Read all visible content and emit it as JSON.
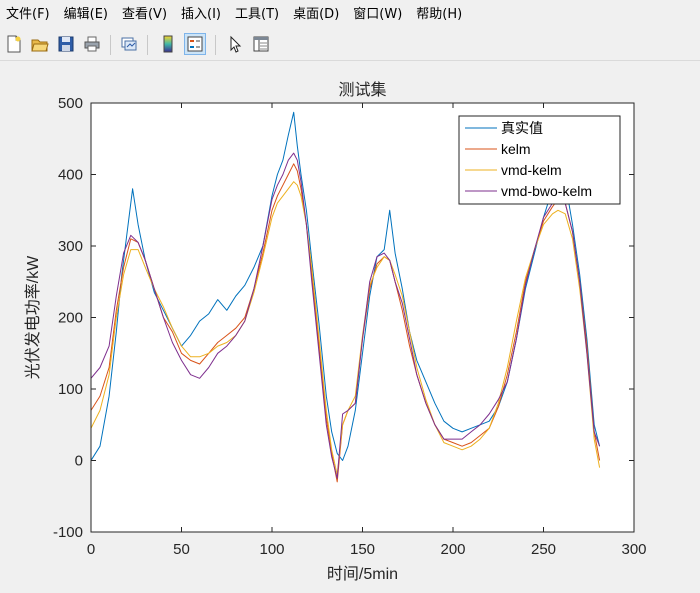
{
  "menu": [
    "文件(F)",
    "编辑(E)",
    "查看(V)",
    "插入(I)",
    "工具(T)",
    "桌面(D)",
    "窗口(W)",
    "帮助(H)"
  ],
  "toolbar": {
    "buttons": [
      "new-figure-icon",
      "open-file-icon",
      "save-icon",
      "print-icon",
      "link-plot-icon",
      "colorbar-icon",
      "legend-icon",
      "pointer-icon",
      "property-editor-icon"
    ],
    "active": "legend-icon"
  },
  "chart_data": {
    "type": "line",
    "title": "测试集",
    "xlabel": "时间/5min",
    "ylabel": "光伏发电功率/kW",
    "xlim": [
      0,
      300
    ],
    "ylim": [
      -100,
      500
    ],
    "xticks": [
      0,
      50,
      100,
      150,
      200,
      250,
      300
    ],
    "yticks": [
      -100,
      0,
      100,
      200,
      300,
      400,
      500
    ],
    "legend_position": "top-right",
    "grid": false,
    "series": [
      {
        "name": "真实值",
        "color": "#0072bd",
        "points": [
          [
            0,
            0
          ],
          [
            5,
            20
          ],
          [
            10,
            90
          ],
          [
            14,
            180
          ],
          [
            17,
            260
          ],
          [
            20,
            320
          ],
          [
            23,
            380
          ],
          [
            26,
            330
          ],
          [
            30,
            280
          ],
          [
            35,
            235
          ],
          [
            40,
            210
          ],
          [
            45,
            185
          ],
          [
            50,
            160
          ],
          [
            55,
            175
          ],
          [
            60,
            195
          ],
          [
            65,
            205
          ],
          [
            70,
            225
          ],
          [
            75,
            210
          ],
          [
            80,
            230
          ],
          [
            85,
            245
          ],
          [
            90,
            270
          ],
          [
            95,
            300
          ],
          [
            100,
            370
          ],
          [
            103,
            400
          ],
          [
            106,
            420
          ],
          [
            109,
            455
          ],
          [
            112,
            487
          ],
          [
            114,
            440
          ],
          [
            116,
            400
          ],
          [
            119,
            350
          ],
          [
            122,
            280
          ],
          [
            126,
            190
          ],
          [
            130,
            90
          ],
          [
            133,
            40
          ],
          [
            136,
            10
          ],
          [
            139,
            0
          ],
          [
            142,
            20
          ],
          [
            146,
            70
          ],
          [
            150,
            150
          ],
          [
            154,
            230
          ],
          [
            158,
            285
          ],
          [
            162,
            295
          ],
          [
            165,
            350
          ],
          [
            168,
            290
          ],
          [
            172,
            240
          ],
          [
            176,
            180
          ],
          [
            180,
            140
          ],
          [
            185,
            110
          ],
          [
            190,
            80
          ],
          [
            195,
            55
          ],
          [
            200,
            45
          ],
          [
            205,
            40
          ],
          [
            210,
            45
          ],
          [
            215,
            50
          ],
          [
            220,
            55
          ],
          [
            225,
            75
          ],
          [
            230,
            110
          ],
          [
            235,
            170
          ],
          [
            240,
            240
          ],
          [
            245,
            290
          ],
          [
            250,
            340
          ],
          [
            255,
            380
          ],
          [
            258,
            400
          ],
          [
            262,
            390
          ],
          [
            266,
            330
          ],
          [
            270,
            260
          ],
          [
            274,
            170
          ],
          [
            278,
            50
          ],
          [
            281,
            20
          ]
        ]
      },
      {
        "name": "kelm",
        "color": "#d95319",
        "points": [
          [
            0,
            70
          ],
          [
            5,
            90
          ],
          [
            10,
            130
          ],
          [
            14,
            210
          ],
          [
            18,
            270
          ],
          [
            22,
            310
          ],
          [
            26,
            305
          ],
          [
            30,
            280
          ],
          [
            35,
            240
          ],
          [
            40,
            200
          ],
          [
            45,
            180
          ],
          [
            50,
            150
          ],
          [
            55,
            140
          ],
          [
            60,
            135
          ],
          [
            65,
            150
          ],
          [
            70,
            165
          ],
          [
            75,
            175
          ],
          [
            80,
            185
          ],
          [
            85,
            200
          ],
          [
            90,
            240
          ],
          [
            95,
            290
          ],
          [
            100,
            350
          ],
          [
            103,
            370
          ],
          [
            106,
            385
          ],
          [
            109,
            400
          ],
          [
            112,
            415
          ],
          [
            114,
            405
          ],
          [
            116,
            380
          ],
          [
            119,
            330
          ],
          [
            122,
            260
          ],
          [
            126,
            160
          ],
          [
            130,
            60
          ],
          [
            133,
            10
          ],
          [
            136,
            -30
          ],
          [
            139,
            50
          ],
          [
            142,
            70
          ],
          [
            146,
            80
          ],
          [
            150,
            170
          ],
          [
            154,
            240
          ],
          [
            158,
            275
          ],
          [
            162,
            285
          ],
          [
            165,
            280
          ],
          [
            168,
            250
          ],
          [
            172,
            210
          ],
          [
            176,
            160
          ],
          [
            180,
            120
          ],
          [
            185,
            80
          ],
          [
            190,
            50
          ],
          [
            195,
            30
          ],
          [
            200,
            25
          ],
          [
            205,
            20
          ],
          [
            210,
            25
          ],
          [
            215,
            35
          ],
          [
            220,
            45
          ],
          [
            225,
            75
          ],
          [
            230,
            120
          ],
          [
            235,
            180
          ],
          [
            240,
            250
          ],
          [
            245,
            295
          ],
          [
            250,
            335
          ],
          [
            255,
            355
          ],
          [
            258,
            365
          ],
          [
            262,
            360
          ],
          [
            266,
            320
          ],
          [
            270,
            250
          ],
          [
            274,
            160
          ],
          [
            278,
            40
          ],
          [
            281,
            0
          ]
        ]
      },
      {
        "name": "vmd-kelm",
        "color": "#edb120",
        "points": [
          [
            0,
            45
          ],
          [
            5,
            70
          ],
          [
            10,
            120
          ],
          [
            14,
            200
          ],
          [
            18,
            260
          ],
          [
            22,
            295
          ],
          [
            26,
            295
          ],
          [
            30,
            270
          ],
          [
            35,
            240
          ],
          [
            40,
            215
          ],
          [
            45,
            185
          ],
          [
            50,
            160
          ],
          [
            55,
            145
          ],
          [
            60,
            145
          ],
          [
            65,
            150
          ],
          [
            70,
            160
          ],
          [
            75,
            165
          ],
          [
            80,
            175
          ],
          [
            85,
            195
          ],
          [
            90,
            235
          ],
          [
            95,
            285
          ],
          [
            100,
            340
          ],
          [
            103,
            360
          ],
          [
            106,
            370
          ],
          [
            109,
            380
          ],
          [
            112,
            390
          ],
          [
            114,
            385
          ],
          [
            116,
            370
          ],
          [
            119,
            330
          ],
          [
            122,
            270
          ],
          [
            126,
            170
          ],
          [
            130,
            70
          ],
          [
            133,
            15
          ],
          [
            136,
            -20
          ],
          [
            139,
            50
          ],
          [
            142,
            70
          ],
          [
            146,
            90
          ],
          [
            150,
            175
          ],
          [
            154,
            245
          ],
          [
            158,
            270
          ],
          [
            162,
            285
          ],
          [
            165,
            280
          ],
          [
            168,
            260
          ],
          [
            172,
            230
          ],
          [
            176,
            180
          ],
          [
            180,
            130
          ],
          [
            185,
            85
          ],
          [
            190,
            50
          ],
          [
            195,
            25
          ],
          [
            200,
            20
          ],
          [
            205,
            15
          ],
          [
            210,
            20
          ],
          [
            215,
            30
          ],
          [
            220,
            45
          ],
          [
            225,
            80
          ],
          [
            230,
            130
          ],
          [
            235,
            195
          ],
          [
            240,
            255
          ],
          [
            245,
            295
          ],
          [
            250,
            330
          ],
          [
            255,
            345
          ],
          [
            258,
            350
          ],
          [
            262,
            345
          ],
          [
            266,
            310
          ],
          [
            270,
            240
          ],
          [
            274,
            150
          ],
          [
            278,
            30
          ],
          [
            281,
            -10
          ]
        ]
      },
      {
        "name": "vmd-bwo-kelm",
        "color": "#7e2f8e",
        "points": [
          [
            0,
            115
          ],
          [
            5,
            130
          ],
          [
            10,
            160
          ],
          [
            14,
            230
          ],
          [
            18,
            290
          ],
          [
            22,
            315
          ],
          [
            26,
            305
          ],
          [
            30,
            280
          ],
          [
            35,
            240
          ],
          [
            40,
            200
          ],
          [
            45,
            165
          ],
          [
            50,
            140
          ],
          [
            55,
            120
          ],
          [
            60,
            115
          ],
          [
            65,
            130
          ],
          [
            70,
            150
          ],
          [
            75,
            160
          ],
          [
            80,
            175
          ],
          [
            85,
            195
          ],
          [
            90,
            240
          ],
          [
            95,
            300
          ],
          [
            100,
            365
          ],
          [
            103,
            385
          ],
          [
            106,
            400
          ],
          [
            109,
            420
          ],
          [
            112,
            430
          ],
          [
            114,
            420
          ],
          [
            116,
            390
          ],
          [
            119,
            330
          ],
          [
            122,
            250
          ],
          [
            126,
            150
          ],
          [
            130,
            50
          ],
          [
            133,
            5
          ],
          [
            136,
            -25
          ],
          [
            139,
            65
          ],
          [
            142,
            70
          ],
          [
            146,
            80
          ],
          [
            150,
            170
          ],
          [
            154,
            250
          ],
          [
            158,
            285
          ],
          [
            162,
            290
          ],
          [
            165,
            280
          ],
          [
            168,
            250
          ],
          [
            172,
            220
          ],
          [
            176,
            170
          ],
          [
            180,
            120
          ],
          [
            185,
            80
          ],
          [
            190,
            50
          ],
          [
            195,
            30
          ],
          [
            200,
            30
          ],
          [
            205,
            30
          ],
          [
            210,
            40
          ],
          [
            215,
            50
          ],
          [
            220,
            65
          ],
          [
            225,
            85
          ],
          [
            230,
            110
          ],
          [
            235,
            170
          ],
          [
            240,
            245
          ],
          [
            245,
            295
          ],
          [
            250,
            340
          ],
          [
            255,
            360
          ],
          [
            258,
            370
          ],
          [
            262,
            360
          ],
          [
            266,
            320
          ],
          [
            270,
            250
          ],
          [
            274,
            150
          ],
          [
            278,
            40
          ],
          [
            281,
            20
          ]
        ]
      }
    ]
  }
}
